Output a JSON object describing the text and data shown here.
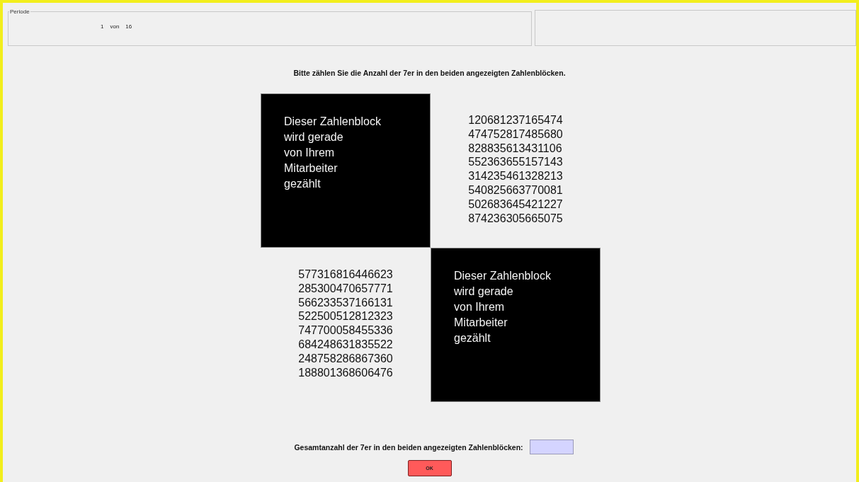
{
  "period_panel": {
    "legend": "Periode",
    "current": "1",
    "separator": "von",
    "total": "16"
  },
  "instruction": "Bitte zählen Sie die Anzahl der 7er in den beiden angezeigten Zahlenblöcken.",
  "blocks": [
    {
      "kind": "covered",
      "text": "Dieser Zahlenblock\nwird gerade\nvon Ihrem\nMitarbeiter\ngezählt"
    },
    {
      "kind": "numbers",
      "rows": [
        "120681237165474",
        "474752817485680",
        "828835613431106",
        "552363655157143",
        "314235461328213",
        "540825663770081",
        "502683645421227",
        "874236305665075"
      ]
    },
    {
      "kind": "numbers",
      "rows": [
        "577316816446623",
        "285300470657771",
        "566233537166131",
        "522500512812323",
        "747700058455336",
        "684248631835522",
        "248758286867360",
        "188801368606476"
      ]
    },
    {
      "kind": "covered",
      "text": "Dieser Zahlenblock\nwird gerade\nvon Ihrem\nMitarbeiter\ngezählt"
    }
  ],
  "answer": {
    "label": "Gesamtanzahl der 7er in den beiden angezeigten Zahlenblöcken:"
  },
  "ok_button": "OK"
}
